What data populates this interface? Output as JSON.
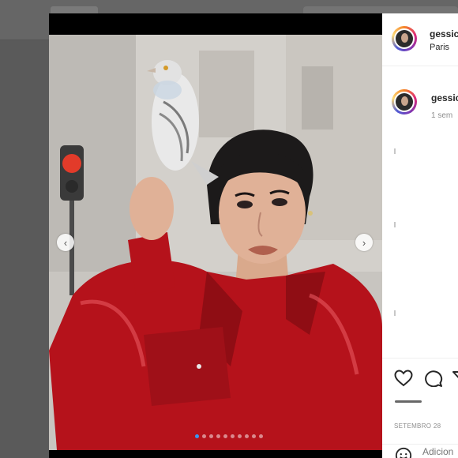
{
  "post": {
    "username": "gessic",
    "location": "Paris",
    "comment": {
      "username": "gessic",
      "time_ago": "1 sem"
    },
    "date": "SETEMBRO 28",
    "comment_placeholder": "Adicion"
  },
  "carousel": {
    "total_slides": 10,
    "active_slide": 1
  },
  "icons": {
    "like": "heart-icon",
    "comment": "comment-icon",
    "share": "share-icon",
    "emoji": "emoji-icon",
    "prev": "chevron-left-icon",
    "next": "chevron-right-icon"
  },
  "colors": {
    "jacket": "#b5121b",
    "active_dot": "#3897f0",
    "avatar_ring": "#dd2a7b"
  }
}
